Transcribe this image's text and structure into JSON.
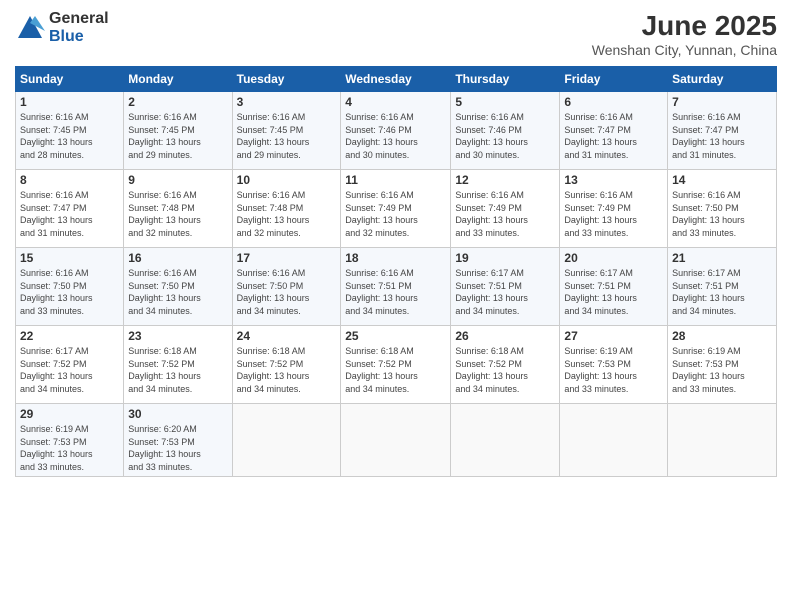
{
  "logo": {
    "general": "General",
    "blue": "Blue"
  },
  "title": "June 2025",
  "location": "Wenshan City, Yunnan, China",
  "weekdays": [
    "Sunday",
    "Monday",
    "Tuesday",
    "Wednesday",
    "Thursday",
    "Friday",
    "Saturday"
  ],
  "days": [
    {
      "number": "1",
      "sunrise": "6:16 AM",
      "sunset": "7:45 PM",
      "daylight": "13 hours and 28 minutes."
    },
    {
      "number": "2",
      "sunrise": "6:16 AM",
      "sunset": "7:45 PM",
      "daylight": "13 hours and 29 minutes."
    },
    {
      "number": "3",
      "sunrise": "6:16 AM",
      "sunset": "7:45 PM",
      "daylight": "13 hours and 29 minutes."
    },
    {
      "number": "4",
      "sunrise": "6:16 AM",
      "sunset": "7:46 PM",
      "daylight": "13 hours and 30 minutes."
    },
    {
      "number": "5",
      "sunrise": "6:16 AM",
      "sunset": "7:46 PM",
      "daylight": "13 hours and 30 minutes."
    },
    {
      "number": "6",
      "sunrise": "6:16 AM",
      "sunset": "7:47 PM",
      "daylight": "13 hours and 31 minutes."
    },
    {
      "number": "7",
      "sunrise": "6:16 AM",
      "sunset": "7:47 PM",
      "daylight": "13 hours and 31 minutes."
    },
    {
      "number": "8",
      "sunrise": "6:16 AM",
      "sunset": "7:47 PM",
      "daylight": "13 hours and 31 minutes."
    },
    {
      "number": "9",
      "sunrise": "6:16 AM",
      "sunset": "7:48 PM",
      "daylight": "13 hours and 32 minutes."
    },
    {
      "number": "10",
      "sunrise": "6:16 AM",
      "sunset": "7:48 PM",
      "daylight": "13 hours and 32 minutes."
    },
    {
      "number": "11",
      "sunrise": "6:16 AM",
      "sunset": "7:49 PM",
      "daylight": "13 hours and 32 minutes."
    },
    {
      "number": "12",
      "sunrise": "6:16 AM",
      "sunset": "7:49 PM",
      "daylight": "13 hours and 33 minutes."
    },
    {
      "number": "13",
      "sunrise": "6:16 AM",
      "sunset": "7:49 PM",
      "daylight": "13 hours and 33 minutes."
    },
    {
      "number": "14",
      "sunrise": "6:16 AM",
      "sunset": "7:50 PM",
      "daylight": "13 hours and 33 minutes."
    },
    {
      "number": "15",
      "sunrise": "6:16 AM",
      "sunset": "7:50 PM",
      "daylight": "13 hours and 33 minutes."
    },
    {
      "number": "16",
      "sunrise": "6:16 AM",
      "sunset": "7:50 PM",
      "daylight": "13 hours and 34 minutes."
    },
    {
      "number": "17",
      "sunrise": "6:16 AM",
      "sunset": "7:50 PM",
      "daylight": "13 hours and 34 minutes."
    },
    {
      "number": "18",
      "sunrise": "6:16 AM",
      "sunset": "7:51 PM",
      "daylight": "13 hours and 34 minutes."
    },
    {
      "number": "19",
      "sunrise": "6:17 AM",
      "sunset": "7:51 PM",
      "daylight": "13 hours and 34 minutes."
    },
    {
      "number": "20",
      "sunrise": "6:17 AM",
      "sunset": "7:51 PM",
      "daylight": "13 hours and 34 minutes."
    },
    {
      "number": "21",
      "sunrise": "6:17 AM",
      "sunset": "7:51 PM",
      "daylight": "13 hours and 34 minutes."
    },
    {
      "number": "22",
      "sunrise": "6:17 AM",
      "sunset": "7:52 PM",
      "daylight": "13 hours and 34 minutes."
    },
    {
      "number": "23",
      "sunrise": "6:18 AM",
      "sunset": "7:52 PM",
      "daylight": "13 hours and 34 minutes."
    },
    {
      "number": "24",
      "sunrise": "6:18 AM",
      "sunset": "7:52 PM",
      "daylight": "13 hours and 34 minutes."
    },
    {
      "number": "25",
      "sunrise": "6:18 AM",
      "sunset": "7:52 PM",
      "daylight": "13 hours and 34 minutes."
    },
    {
      "number": "26",
      "sunrise": "6:18 AM",
      "sunset": "7:52 PM",
      "daylight": "13 hours and 34 minutes."
    },
    {
      "number": "27",
      "sunrise": "6:19 AM",
      "sunset": "7:53 PM",
      "daylight": "13 hours and 33 minutes."
    },
    {
      "number": "28",
      "sunrise": "6:19 AM",
      "sunset": "7:53 PM",
      "daylight": "13 hours and 33 minutes."
    },
    {
      "number": "29",
      "sunrise": "6:19 AM",
      "sunset": "7:53 PM",
      "daylight": "13 hours and 33 minutes."
    },
    {
      "number": "30",
      "sunrise": "6:20 AM",
      "sunset": "7:53 PM",
      "daylight": "13 hours and 33 minutes."
    }
  ]
}
